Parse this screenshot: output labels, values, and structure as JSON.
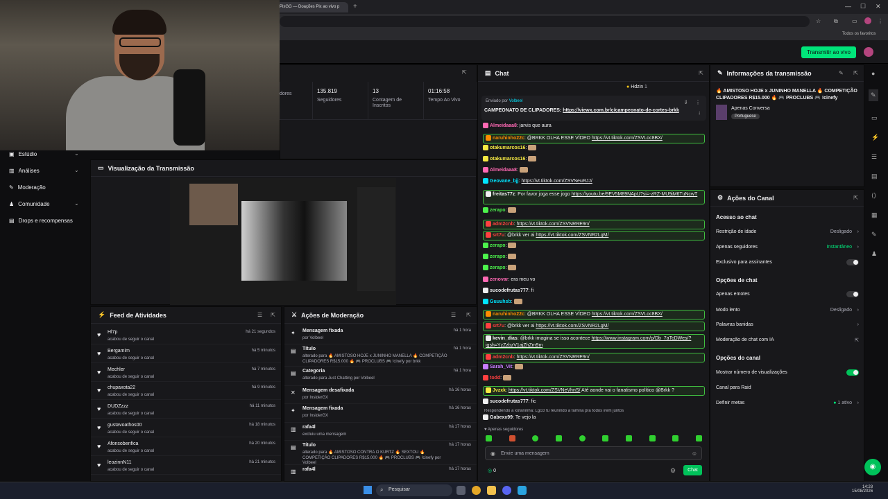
{
  "browser": {
    "tab_title": "PixGG — Doações Pix ao vivo p",
    "newtab": "+",
    "bookmarks_label": "Todos os favoritos"
  },
  "header": {
    "go_live": "Transmitir ao vivo"
  },
  "sidebar": {
    "items": [
      {
        "label": "Estúdio",
        "icon": "video-icon",
        "chev": "⌄"
      },
      {
        "label": "Análises",
        "icon": "chart-icon",
        "chev": "⌄"
      },
      {
        "label": "Moderação",
        "icon": "wrench-icon",
        "chev": ""
      },
      {
        "label": "Comunidade",
        "icon": "people-icon",
        "chev": "⌄"
      },
      {
        "label": "Drops e recompensas",
        "icon": "gift-icon",
        "chev": ""
      }
    ]
  },
  "stats": [
    {
      "value": "",
      "label": "dores"
    },
    {
      "value": "135.819",
      "label": "Seguidores"
    },
    {
      "value": "13",
      "label": "Contagem de Inscritos"
    },
    {
      "value": "01:16:58",
      "label": "Tempo Ao Vivo"
    }
  ],
  "preview": {
    "title": "Visualização da Transmissão"
  },
  "feed": {
    "title": "Feed de Atividades",
    "rows": [
      {
        "name": "Hl7p",
        "action": "acabou de seguir o canal",
        "time": "há 21 segundos"
      },
      {
        "name": "Bergamim",
        "action": "acabou de seguir o canal",
        "time": "há 5 minutos"
      },
      {
        "name": "Mechler",
        "action": "acabou de seguir o canal",
        "time": "há 7 minutos"
      },
      {
        "name": "chupaxota22",
        "action": "acabou de seguir o canal",
        "time": "há 9 minutos"
      },
      {
        "name": "DUDZzzz",
        "action": "acabou de seguir o canal",
        "time": "há 11 minutos"
      },
      {
        "name": "gustavoathos00",
        "action": "acabou de seguir o canal",
        "time": "há 18 minutos"
      },
      {
        "name": "Afonsobenfica",
        "action": "acabou de seguir o canal",
        "time": "há 20 minutos"
      },
      {
        "name": "leozinnN11",
        "action": "acabou de seguir o canal",
        "time": "há 21 minutos"
      }
    ]
  },
  "mod": {
    "title": "Ações de Moderação",
    "rows": [
      {
        "title": "Mensagem fixada",
        "desc": "por Volbeel",
        "time": "há 1 hora",
        "icon": "pin-icon"
      },
      {
        "title": "Título",
        "desc": "alterado para 🔥 AMISTOSO HOJE x JUNINHO MANELLA 🔥 COMPETIÇÃO CLIPADORES R$15.000 🔥 🎮 PROCLUBS 🎮 !cinefy por brkk",
        "time": "há 1 hora",
        "icon": "doc-icon"
      },
      {
        "title": "Categoria",
        "desc": "alterado para Just Chatting por Volbeel",
        "time": "há 1 hora",
        "icon": "doc-icon"
      },
      {
        "title": "Mensagem desafixada",
        "desc": "por InsiderGX",
        "time": "há 16 horas",
        "icon": "unpin-icon"
      },
      {
        "title": "Mensagem fixada",
        "desc": "por InsiderGX",
        "time": "há 16 horas",
        "icon": "pin-icon"
      },
      {
        "title": "rafa4l",
        "desc": "excluiu uma mensagem",
        "time": "há 17 horas",
        "icon": "trash-icon"
      },
      {
        "title": "Título",
        "desc": "alterado para 🔥 AMISTOSO CONTRA O KURTZ 🔥 SEXTOU 🔥 COMPETIÇÃO CLIPADORES R$15.000 🔥 🎮 PROCLUBS 🎮 !cinefy por Volbeel",
        "time": "há 17 horas",
        "icon": "doc-icon"
      },
      {
        "title": "rafa4l",
        "desc": "",
        "time": "há 17 horas",
        "icon": "trash-icon"
      }
    ]
  },
  "chat": {
    "title": "Chat",
    "top_user": "Hdzin",
    "top_count": "1",
    "pinned_by_label": "Enviado por",
    "pinned_by": "Volbeel",
    "pinned_text": "CAMPEONATO DE CLIPADORES: ",
    "pinned_link": "https://viewx.com.br/c/campeonato-de-cortes-brkk",
    "messages": [
      {
        "user": "Almeidaaa8",
        "color": "#ff69b4",
        "text": ": jarvis que aura",
        "link": "",
        "hl": false
      },
      {
        "user": "naruhinho22c",
        "color": "#ff8c00",
        "text": ": @BRKK OLHA ESSE VÍDEO ",
        "link": "https://vt.tiktok.com/ZSVLoc8BX/",
        "hl": true
      },
      {
        "user": "otakumarcos16",
        "color": "#f5e942",
        "text": ":",
        "link": "",
        "hl": false
      },
      {
        "user": "otakumarcos16",
        "color": "#f5e942",
        "text": ":",
        "link": "",
        "hl": false
      },
      {
        "user": "Almeidaaa8",
        "color": "#ff69b4",
        "text": ":",
        "link": "",
        "hl": false
      },
      {
        "user": "Geovane_bjj",
        "color": "#00e5ff",
        "text": ": ",
        "link": "https://vt.tiktok.com/ZSVNeuRJJ/",
        "hl": false
      },
      {
        "user": "freitas77z",
        "color": "#efeff1",
        "text": ": Por favor joga esse jogo ",
        "link": "https://youtu.be/9EV5M89NApU?si=-zRZ-MU9jM6TuNcwT",
        "hl": true
      },
      {
        "user": "zerapo",
        "color": "#4cf24c",
        "text": ":",
        "link": "",
        "hl": false
      },
      {
        "user": "adm2cnb",
        "color": "#ff4040",
        "text": ": ",
        "link": "https://vt.tiktok.com/ZSVNRRE9n/",
        "hl": true
      },
      {
        "user": "srt7u",
        "color": "#ff4040",
        "text": ": @brkk ver ai ",
        "link": "https://vt.tiktok.com/ZSVNR2LgM/",
        "hl": true
      },
      {
        "user": "zerapo",
        "color": "#4cf24c",
        "text": ":",
        "link": "",
        "hl": false
      },
      {
        "user": "zerapo",
        "color": "#4cf24c",
        "text": ":",
        "link": "",
        "hl": false
      },
      {
        "user": "zerapo",
        "color": "#4cf24c",
        "text": ":",
        "link": "",
        "hl": false
      },
      {
        "user": "zenovar",
        "color": "#ff69b4",
        "text": ": era meu vo",
        "link": "",
        "hl": false
      },
      {
        "user": "sucodefrutas777",
        "color": "#efeff1",
        "text": ": fi",
        "link": "",
        "hl": false
      },
      {
        "user": "Guuuhsb",
        "color": "#00e5ff",
        "text": ":",
        "link": "",
        "hl": false
      },
      {
        "user": "naruhinho22c",
        "color": "#ff8c00",
        "text": ": @BRKK OLHA ESSE VÍDEO ",
        "link": "https://vt.tiktok.com/ZSVLoc8BX/",
        "hl": true
      },
      {
        "user": "srt7u",
        "color": "#ff4040",
        "text": ": @brkk ver ai ",
        "link": "https://vt.tiktok.com/ZSVNR2LgM/",
        "hl": true
      },
      {
        "user": "kevin_dias",
        "color": "#efeff1",
        "text": ": @brkk imagina se isso acontece ",
        "link": "https://www.instagram.com/p/Db_7aTcDWes/?igsh=YzZzbzV1ajZhZm9m",
        "hl": true
      },
      {
        "user": "adm2cnb",
        "color": "#ff4040",
        "text": ": ",
        "link": "https://vt.tiktok.com/ZSVNRRE9n/",
        "hl": true
      },
      {
        "user": "Sarah_Vit",
        "color": "#c77dff",
        "text": ":",
        "link": "",
        "hl": false
      },
      {
        "user": "todd",
        "color": "#ff4040",
        "text": ":",
        "link": "",
        "hl": false
      },
      {
        "user": "Jvzxk",
        "color": "#f5e942",
        "text": ": ",
        "link": "https://vt.tiktok.com/ZSVNeVhnS/",
        "tail": " Até aonde vai o fanatismo político @Brkk ?",
        "hl": true
      },
      {
        "user": "sucodefrutas777",
        "color": "#efeff1",
        "text": ": fic",
        "link": "",
        "hl": false
      },
      {
        "user": "Gabexx99",
        "color": "#efeff1",
        "text": ": Te vejo la",
        "link": "",
        "hl": false
      }
    ],
    "reply_hint": "Respondendo a xofaninha: Lgccl tu reunindo a família pra todos irem juntos",
    "followers_only": "Apenas seguidores",
    "input_placeholder": "Envie uma mensagem",
    "points": "0",
    "send": "Chat"
  },
  "info": {
    "title": "Informações da transmissão",
    "stream_title": "🔥 AMISTOSO HOJE x JUNINHO MANELLA 🔥 COMPETIÇÃO CLIPADORES R$15.000 🔥 🎮 PROCLUBS 🎮 !cinefy",
    "category": "Apenas Conversa",
    "language": "Portuguese"
  },
  "actions": {
    "title": "Ações do Canal",
    "sec1": "Acesso ao chat",
    "r_idade": "Restrição de idade",
    "r_idade_val": "Desligado",
    "seguidores": "Apenas seguidores",
    "seguidores_val": "Instantâneo",
    "assinantes": "Exclusivo para assinantes",
    "sec2": "Opções de chat",
    "emotes": "Apenas emotes",
    "lento": "Modo lento",
    "lento_val": "Desligado",
    "banidas": "Palavras banidas",
    "ia": "Moderação de chat com IA",
    "sec3": "Opções do canal",
    "views": "Mostrar número de visualizações",
    "raid": "Canal para Raid",
    "metas": "Definir metas",
    "metas_val": "1 ativo"
  },
  "taskbar": {
    "search": "Pesquisar",
    "time": "14:28",
    "date": "15/08/2026"
  },
  "colors": {
    "accent": "#00e57a",
    "highlight_border": "#40c040",
    "panel": "#18181b"
  }
}
